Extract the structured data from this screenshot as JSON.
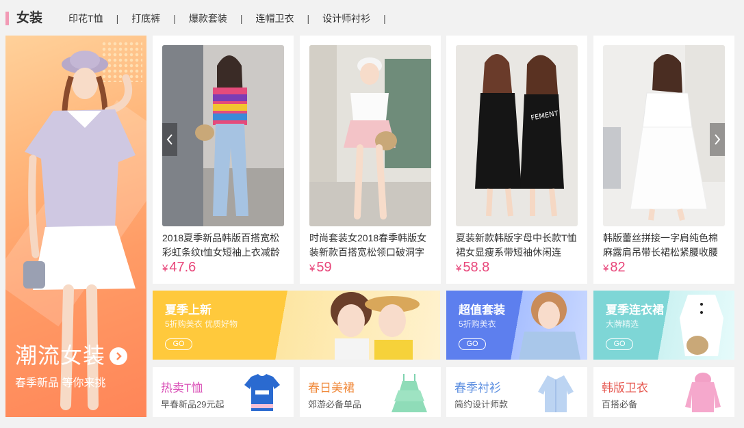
{
  "header": {
    "title": "女装",
    "nav": [
      "印花T恤",
      "打底裤",
      "爆款套装",
      "连帽卫衣",
      "设计师衬衫"
    ],
    "separator": "|"
  },
  "left_banner": {
    "title": "潮流女装",
    "subtitle": "春季新品 等你来挑",
    "arrow_icon": "chevron-right-icon"
  },
  "products": [
    {
      "title": "2018夏季新品韩版百搭宽松彩虹条纹t恤女短袖上衣减龄",
      "currency": "¥",
      "price": "47.6"
    },
    {
      "title": "时尚套装女2018春季韩版女装新款百搭宽松领口破洞字",
      "currency": "¥",
      "price": "59"
    },
    {
      "title": "夏装新款韩版字母中长款T恤裙女显瘦系带短袖休闲连",
      "currency": "¥",
      "price": "58.8"
    },
    {
      "title": "韩版蕾丝拼接一字肩纯色棉麻露肩吊带长裙松紧腰收腰",
      "currency": "¥",
      "price": "82"
    }
  ],
  "carousel": {
    "prev_icon": "chevron-left-icon",
    "next_icon": "chevron-right-icon"
  },
  "promos": [
    {
      "title": "夏季上新",
      "subtitle": "5折购美衣 优质好物",
      "go": "GO",
      "color": "#ffc93c"
    },
    {
      "title": "超值套装",
      "subtitle": "5折购美衣",
      "go": "GO",
      "color": "#6a8bf0"
    },
    {
      "title": "夏季连衣裙",
      "subtitle": "大牌精选",
      "go": "GO",
      "color": "#8fe0e0"
    }
  ],
  "minis": [
    {
      "title": "热卖T恤",
      "subtitle": "早春新品29元起",
      "color": "#d94bb5"
    },
    {
      "title": "春日美裙",
      "subtitle": "郊游必备单品",
      "color": "#f08a3c"
    },
    {
      "title": "春季衬衫",
      "subtitle": "简约设计师款",
      "color": "#5a8de0"
    },
    {
      "title": "韩版卫衣",
      "subtitle": "百搭必备",
      "color": "#e6574f"
    }
  ],
  "colors": {
    "price": "#e8467a",
    "accent_marker": "#f29ab5"
  }
}
